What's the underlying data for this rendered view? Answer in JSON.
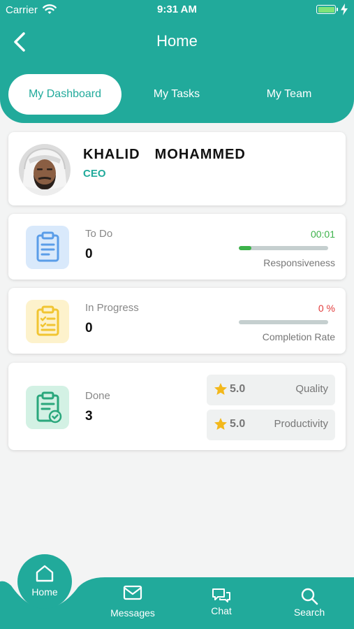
{
  "status_bar": {
    "carrier": "Carrier",
    "time": "9:31 AM"
  },
  "nav": {
    "title": "Home"
  },
  "tabs": [
    {
      "label": "My Dashboard"
    },
    {
      "label": "My Tasks"
    },
    {
      "label": "My Team"
    }
  ],
  "profile": {
    "name": "KHALID  MOHAMMED",
    "role": "CEO"
  },
  "stats": {
    "todo": {
      "label": "To Do",
      "value": "0",
      "metric_value": "00:01",
      "metric_label": "Responsiveness",
      "progress": 0.14
    },
    "in_progress": {
      "label": "In Progress",
      "value": "0",
      "metric_value": "0 %",
      "metric_label": "Completion Rate",
      "progress": 0
    },
    "done": {
      "label": "Done",
      "value": "3",
      "ratings": [
        {
          "value": "5.0",
          "label": "Quality"
        },
        {
          "value": "5.0",
          "label": "Productivity"
        }
      ]
    }
  },
  "tabbar": {
    "home": "Home",
    "messages": "Messages",
    "chat": "Chat",
    "search": "Search"
  },
  "colors": {
    "primary": "#21aa9b",
    "todo_icon": "#5a9de8",
    "progress_icon": "#f1c532",
    "done_icon": "#2aa77c",
    "timer": "#3cb24a",
    "rate": "#e23c3c",
    "star": "#f3b81b"
  }
}
